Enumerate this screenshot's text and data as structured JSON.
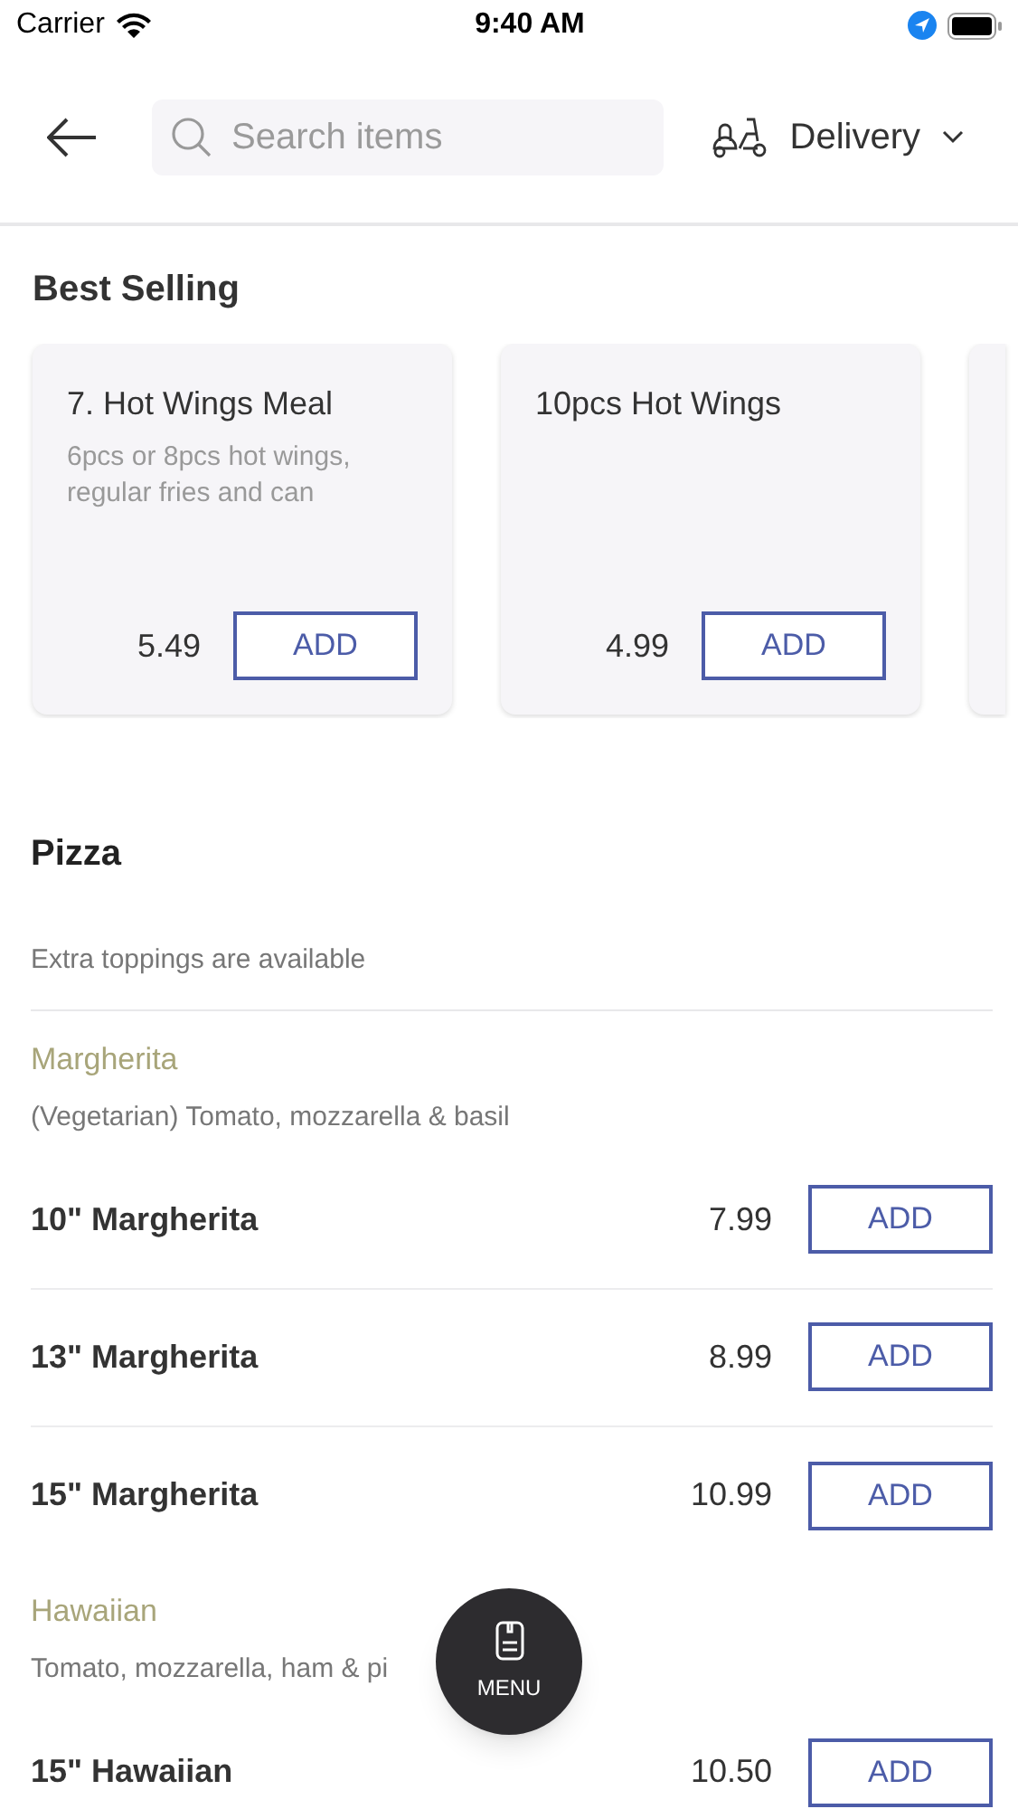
{
  "status_bar": {
    "carrier": "Carrier",
    "time": "9:40 AM"
  },
  "header": {
    "search": {
      "placeholder": "Search items"
    },
    "order_type": "Delivery"
  },
  "best_selling": {
    "title": "Best Selling",
    "items": [
      {
        "name": "7. Hot Wings Meal",
        "description": "6pcs or 8pcs hot wings, regular fries and can",
        "price": "5.49",
        "button": "ADD"
      },
      {
        "name": "10pcs Hot Wings",
        "price": "4.99",
        "button": "ADD"
      }
    ]
  },
  "sections": [
    {
      "title": "Pizza",
      "note": "Extra toppings are available",
      "groups": [
        {
          "name": "Margherita",
          "description": "(Vegetarian) Tomato, mozzarella & basil",
          "items": [
            {
              "name": "10\" Margherita",
              "price": "7.99",
              "button": "ADD"
            },
            {
              "name": "13\" Margherita",
              "price": "8.99",
              "button": "ADD"
            },
            {
              "name": "15\" Margherita",
              "price": "10.99",
              "button": "ADD"
            }
          ]
        },
        {
          "name": "Hawaiian",
          "description": "Tomato, mozzarella, ham & pi",
          "items": [
            {
              "name": "15\" Hawaiian",
              "price": "10.50",
              "button": "ADD"
            }
          ]
        }
      ]
    }
  ],
  "menu_button": {
    "label": "MENU"
  }
}
